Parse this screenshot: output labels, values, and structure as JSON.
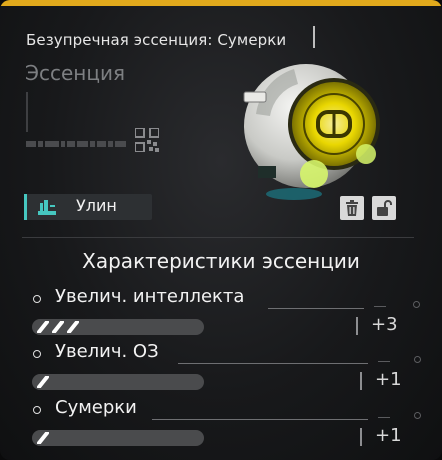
{
  "colors": {
    "accent_top": "#e1a91c",
    "tag_accent": "#46c7c0",
    "sphere_glow": "#f3e000"
  },
  "header": {
    "title": "Безупречная эссенция: Сумерки",
    "subtitle": "Эссенция"
  },
  "item": {
    "owner_tag": "Улин",
    "owner_icon": "character-class-icon",
    "image": "essence-sphere-image",
    "actions": [
      {
        "name": "delete",
        "icon": "trash-icon"
      },
      {
        "name": "lock",
        "icon": "unlock-icon"
      }
    ]
  },
  "stats": {
    "title": "Характеристики эссенции",
    "items": [
      {
        "name": "Увелич. интеллекта",
        "level": 3,
        "value": "+3"
      },
      {
        "name": "Увелич. ОЗ",
        "level": 1,
        "value": "+1"
      },
      {
        "name": "Сумерки",
        "level": 1,
        "value": "+1"
      }
    ]
  }
}
